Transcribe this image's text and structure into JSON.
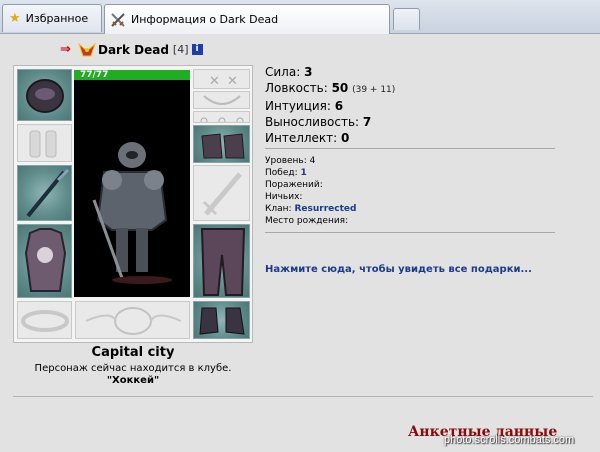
{
  "browser": {
    "tabs": [
      {
        "label": "Избранное",
        "icon": "star-icon"
      },
      {
        "label": "Информация о Dark Dead",
        "icon": "crossed-swords-icon"
      }
    ]
  },
  "character": {
    "name": "Dark Dead",
    "level": "[4]",
    "info_badge": "i",
    "hp": "77/77",
    "location": "Capital city",
    "status_note": "Персонаж сейчас находится в клубе.",
    "club": "\"Хоккей\""
  },
  "stats": [
    {
      "label": "Сила:",
      "value": "3",
      "extra": ""
    },
    {
      "label": "Ловкость:",
      "value": "50",
      "extra": "(39 + 11)"
    },
    {
      "label": "Интуиция:",
      "value": "6",
      "extra": ""
    },
    {
      "label": "Выносливость:",
      "value": "7",
      "extra": ""
    },
    {
      "label": "Интеллект:",
      "value": "0",
      "extra": ""
    }
  ],
  "meta": {
    "level_label": "Уровень:",
    "level_value": "4",
    "wins_label": "Побед:",
    "wins_value": "1",
    "losses_label": "Поражений:",
    "draws_label": "Ничьих:",
    "clan_label": "Клан:",
    "clan_value": "Resurrected",
    "birthplace_label": "Место рождения:"
  },
  "gifts_link": "Нажмите сюда, чтобы увидеть все подарки...",
  "profile_heading": "Анкетные данные",
  "watermark": "photo.scrolls.combats.com",
  "colors": {
    "link": "#1a3a8c",
    "hp": "#1fae21",
    "heading": "#8b0a0a",
    "slot": "#5f8b8b"
  }
}
